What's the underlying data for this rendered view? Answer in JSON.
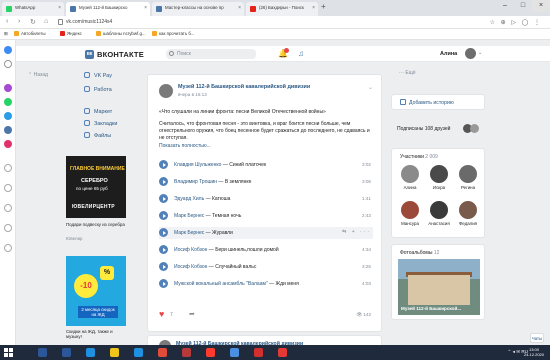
{
  "browser": {
    "tabs": [
      {
        "label": "WhatsApp",
        "color": "#25d366"
      },
      {
        "label": "Музей 112-й Башкирско",
        "color": "#4a76a8"
      },
      {
        "label": "Мастер-классы на основе пр",
        "color": "#4a76a8"
      },
      {
        "label": "(26) Бахдирьи - Поиск",
        "color": "#e62117"
      }
    ],
    "url": "vk.com/music1124s4",
    "bookmarks": [
      "Автобилеты",
      "Яндекс",
      "шаблоны ncrybwf.g...",
      "как прочитать б..."
    ]
  },
  "vk": {
    "logo_text": "ВКОНТАКТЕ",
    "search_placeholder": "Поиск",
    "user_name": "Алина",
    "back": "Назад",
    "nav": [
      "VK Pay",
      "Работа",
      "Маркет",
      "Закладки",
      "Файлы"
    ],
    "ad1": {
      "line1": "ГЛАВНОЕ ВНИМАНИЕ",
      "line2": "СЕРЕБРО",
      "line3": "по цене 65 руб",
      "brand": "ЮВЕЛИРЦЕНТР",
      "caption": "Подари подвеску из серебра",
      "sub": "Ювелир"
    },
    "ad2": {
      "badge_pct": "%",
      "badge_ten": "-10",
      "caption": "2 месяца скидок на ЖД",
      "title": "Скидки на ЖД, также и музыку!"
    }
  },
  "post": {
    "author": "Музей 112-й Башкирской кавалерийской дивизии",
    "date": "вчера в 16:13",
    "line1": "«Что слушали на линии фронта: песни Великой Отечественной войны»",
    "text": "Считалось, что фронтовая песня - это винтовка, и враг боится песни больше, чем огнестрельного оружия, что боец песенное будет сражаться до последнего, не сдаваясь и не отступая.",
    "more": "Показать полностью...",
    "tracks": [
      {
        "artist": "Клавдия Шульженко",
        "song": "Синий платочек",
        "duration": "3:02"
      },
      {
        "artist": "Владимир Трошин",
        "song": "В землянке",
        "duration": "3:06"
      },
      {
        "artist": "Эдуард Хиль",
        "song": "Катюша",
        "duration": "1:41"
      },
      {
        "artist": "Марк Бернес",
        "song": "Темная ночь",
        "duration": "2:43"
      },
      {
        "artist": "Марк Бернес",
        "song": "Журавли",
        "duration": ""
      },
      {
        "artist": "Иосиф Кобзон",
        "song": "Бери шинель,пошли домой",
        "duration": "4:34"
      },
      {
        "artist": "Иосиф Кобзон",
        "song": "Случайный вальс",
        "duration": "3:26"
      },
      {
        "artist": "Мужской вокальный ансамбль \"Валаам\"",
        "song": "Жди меня",
        "duration": "4:03"
      }
    ],
    "likes": "7",
    "views": "142"
  },
  "post2": {
    "author": "Музей 112-й Башкирской кавалерийской дивизии"
  },
  "right": {
    "back": "Ещё",
    "add_story": "Добавить историю",
    "subs": "Подписаны 108 друзей",
    "members_title": "Участники",
    "members_count": "2 009",
    "members": [
      "Алина",
      "Искра",
      "Регина",
      "Мансура",
      "Анастасия",
      "Федалия"
    ],
    "photos_title": "Фотоальбомы",
    "photos_count": "12",
    "photo_caption": "Музей 112-й Башкирской..."
  },
  "chat_label": "Чаты",
  "taskbar": {
    "lang": "RU",
    "time": "13:00",
    "date": "24.12.2020"
  }
}
